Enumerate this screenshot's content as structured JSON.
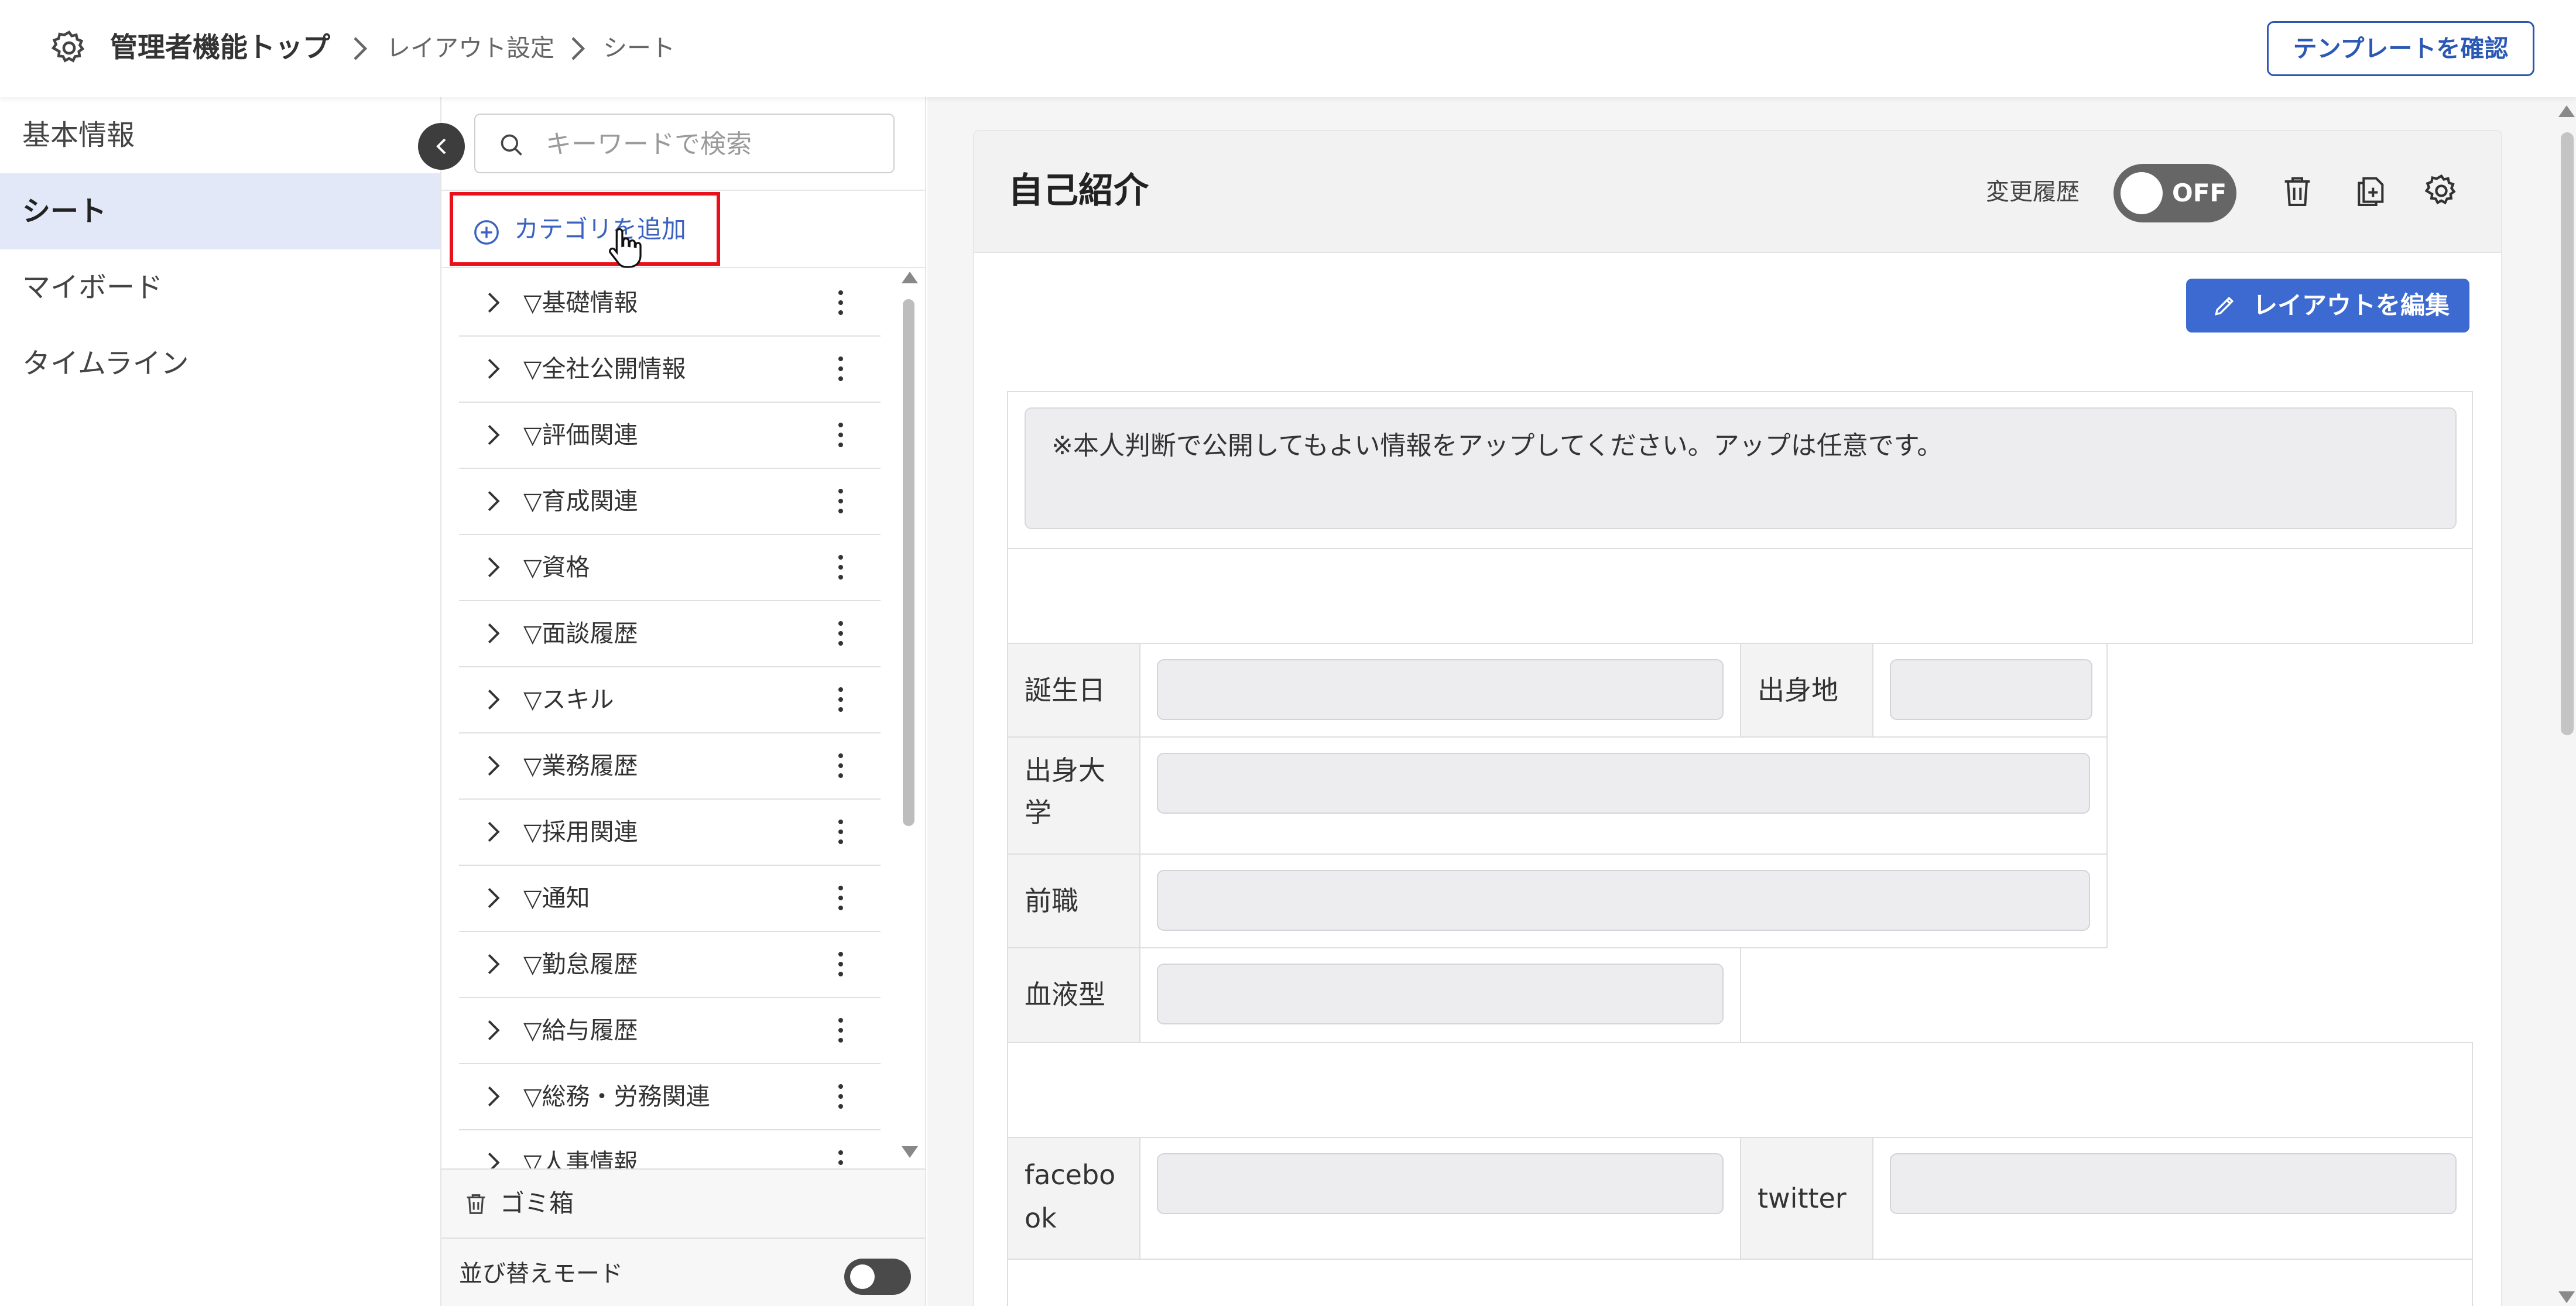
{
  "header": {
    "breadcrumb_root": "管理者機能トップ",
    "breadcrumb_1": "レイアウト設定",
    "breadcrumb_2": "シート",
    "template_button": "テンプレートを確認"
  },
  "sidebar": {
    "items": [
      {
        "label": "基本情報"
      },
      {
        "label": "シート"
      },
      {
        "label": "マイボード"
      },
      {
        "label": "タイムライン"
      }
    ]
  },
  "category_panel": {
    "search_placeholder": "キーワードで検索",
    "add_category": "カテゴリを追加",
    "categories": [
      {
        "label": "▽基礎情報"
      },
      {
        "label": "▽全社公開情報"
      },
      {
        "label": "▽評価関連"
      },
      {
        "label": "▽育成関連"
      },
      {
        "label": "▽資格"
      },
      {
        "label": "▽面談履歴"
      },
      {
        "label": "▽スキル"
      },
      {
        "label": "▽業務履歴"
      },
      {
        "label": "▽採用関連"
      },
      {
        "label": "▽通知"
      },
      {
        "label": "▽勤怠履歴"
      },
      {
        "label": "▽給与履歴"
      },
      {
        "label": "▽総務・労務関連"
      },
      {
        "label": "▽人事情報"
      }
    ],
    "trash": "ゴミ箱",
    "sort_mode": "並び替えモード"
  },
  "sheet": {
    "title": "自己紹介",
    "history_label": "変更履歴",
    "history_toggle": "OFF",
    "edit_layout": "レイアウトを編集",
    "note": "※本人判断で公開してもよい情報をアップしてください。アップは任意です。",
    "fields": {
      "birthday": "誕生日",
      "birthplace": "出身地",
      "university": "出身大学",
      "previous_job": "前職",
      "blood_type": "血液型",
      "facebook": "facebook",
      "twitter": "twitter"
    }
  },
  "colors": {
    "accent": "#3d6ad0",
    "highlight": "#e8101a",
    "active_nav": "#e3e8f8"
  }
}
